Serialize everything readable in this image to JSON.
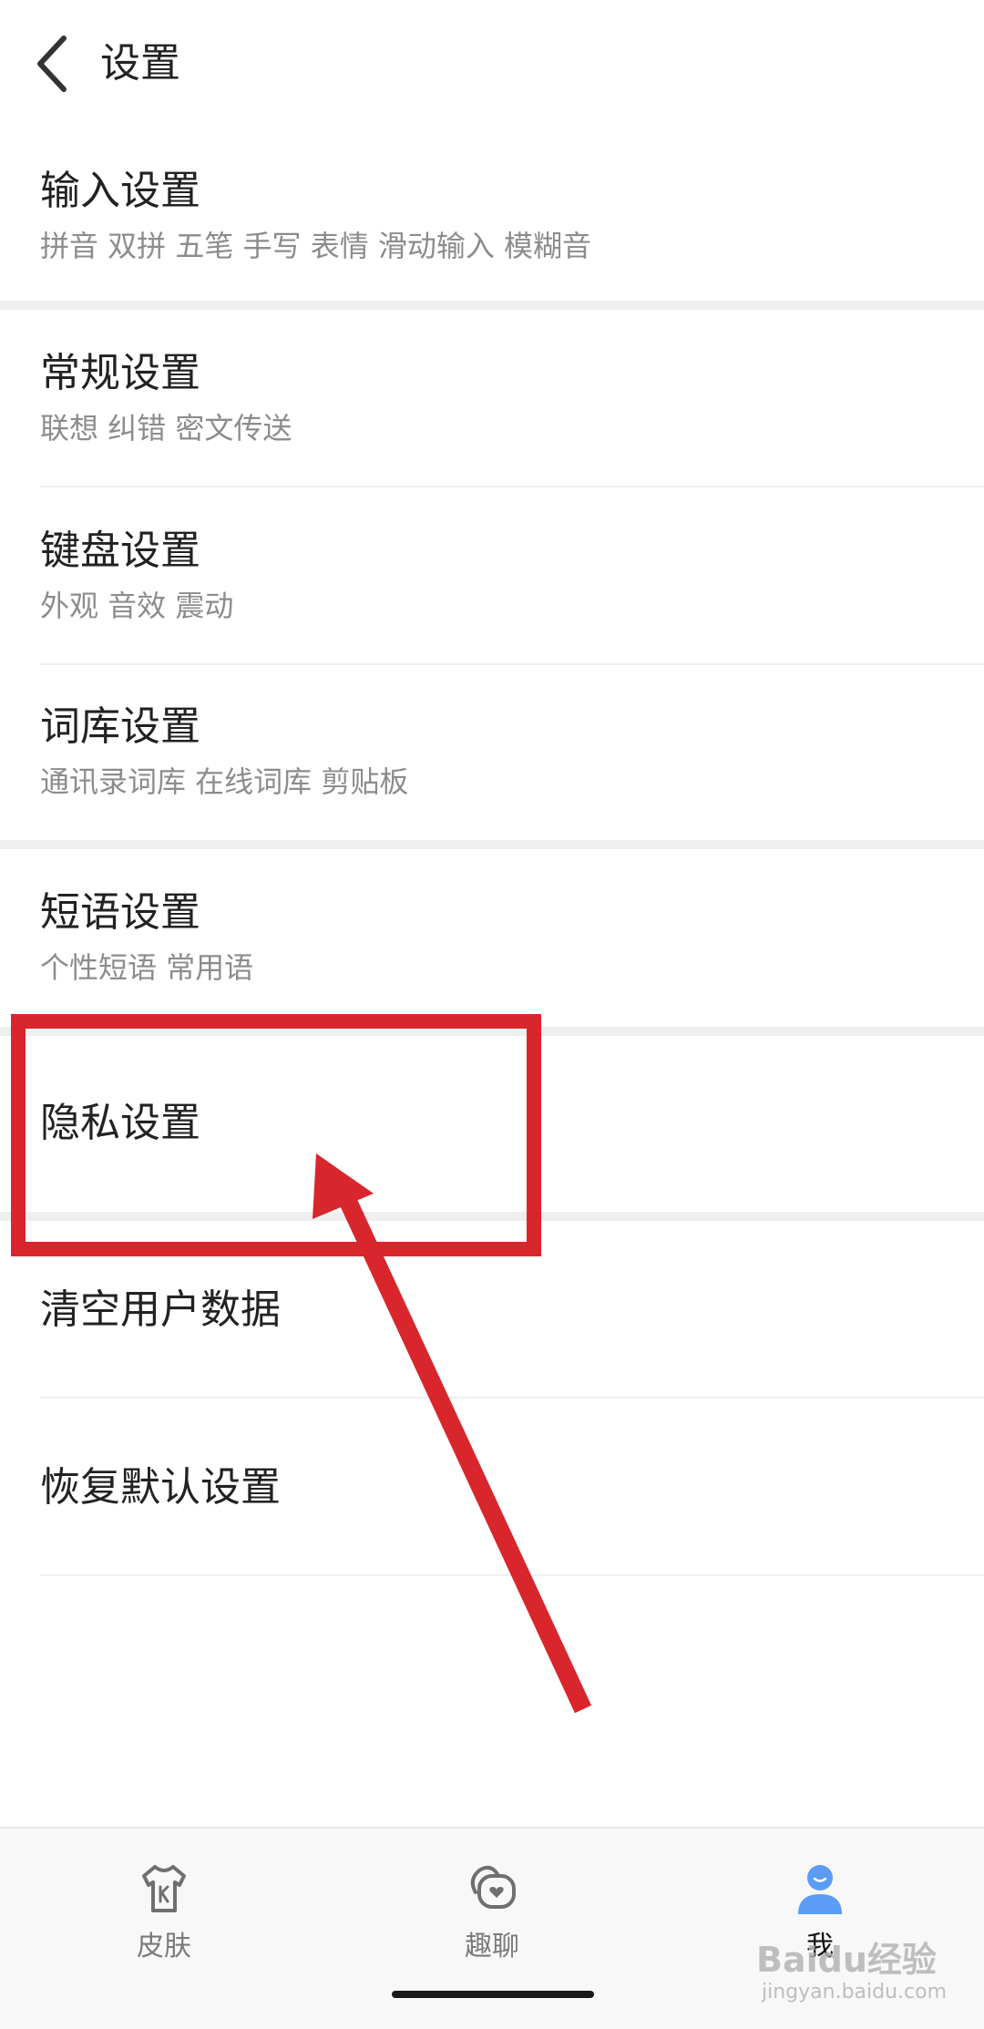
{
  "header": {
    "title": "设置",
    "back_icon": "chevron-left-icon"
  },
  "items": [
    {
      "title": "输入设置",
      "subtitle": "拼音 双拼 五笔 手写 表情 滑动输入 模糊音"
    },
    {
      "title": "常规设置",
      "subtitle": "联想 纠错 密文传送"
    },
    {
      "title": "键盘设置",
      "subtitle": "外观 音效 震动"
    },
    {
      "title": "词库设置",
      "subtitle": "通讯录词库 在线词库 剪贴板"
    },
    {
      "title": "短语设置",
      "subtitle": "个性短语 常用语"
    },
    {
      "title": "隐私设置"
    },
    {
      "title": "清空用户数据"
    },
    {
      "title": "恢复默认设置"
    }
  ],
  "tabs": [
    {
      "label": "皮肤",
      "icon": "tshirt-icon",
      "active": false
    },
    {
      "label": "趣聊",
      "icon": "chat-heart-icon",
      "active": false
    },
    {
      "label": "我",
      "icon": "user-icon",
      "active": true
    }
  ],
  "watermark": {
    "logo": "Baidu经验",
    "url": "jingyan.baidu.com"
  },
  "colors": {
    "active_tab": "#5b9cf6",
    "annotation": "#d9262c",
    "divider": "#efefef"
  }
}
